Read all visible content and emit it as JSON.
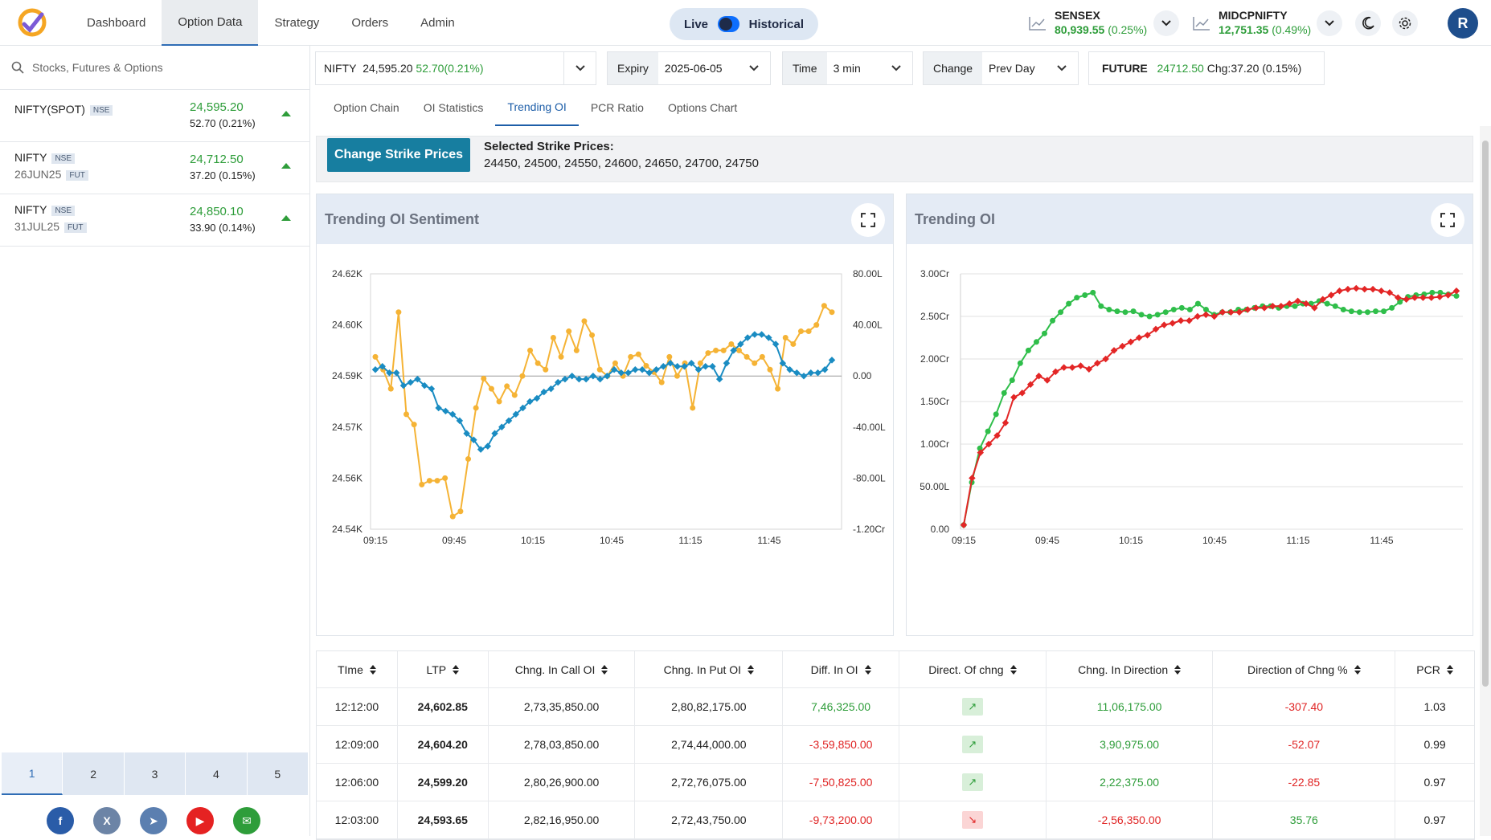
{
  "nav": {
    "items": [
      "Dashboard",
      "Option Data",
      "Strategy",
      "Orders",
      "Admin"
    ],
    "active": "Option Data"
  },
  "mode": {
    "live": "Live",
    "historical": "Historical"
  },
  "indices": [
    {
      "name": "SENSEX",
      "value": "80,939.55",
      "change": "(0.25%)"
    },
    {
      "name": "MIDCPNIFTY",
      "value": "12,751.35",
      "change": "(0.49%)"
    }
  ],
  "user": {
    "initial": "R"
  },
  "search": {
    "placeholder": "Stocks, Futures & Options"
  },
  "watchlist": [
    {
      "symbol": "NIFTY(SPOT)",
      "exchange": "NSE",
      "sub": "",
      "type": "",
      "ltp": "24,595.20",
      "change": "52.70 (0.21%)"
    },
    {
      "symbol": "NIFTY",
      "exchange": "NSE",
      "sub": "26JUN25",
      "type": "FUT",
      "ltp": "24,712.50",
      "change": "37.20 (0.15%)"
    },
    {
      "symbol": "NIFTY",
      "exchange": "NSE",
      "sub": "31JUL25",
      "type": "FUT",
      "ltp": "24,850.10",
      "change": "33.90 (0.14%)"
    }
  ],
  "pager": [
    "1",
    "2",
    "3",
    "4",
    "5"
  ],
  "filters": {
    "symbol": "NIFTY",
    "symbol_price": "24,595.20",
    "symbol_change": "52.70(0.21%)",
    "expiry_label": "Expiry",
    "expiry": "2025-06-05",
    "time_label": "Time",
    "time": "3 min",
    "change_label": "Change",
    "change": "Prev Day",
    "future_label": "FUTURE",
    "future_price": "24712.50",
    "future_change": "Chg:37.20 (0.15%)"
  },
  "tabs": [
    "Option Chain",
    "OI Statistics",
    "Trending OI",
    "PCR Ratio",
    "Options Chart"
  ],
  "strike": {
    "button": "Change Strike Prices",
    "title": "Selected Strike Prices:",
    "list": "24450, 24500, 24550, 24600, 24650, 24700, 24750"
  },
  "panels": {
    "left_title": "Trending OI Sentiment",
    "right_title": "Trending OI"
  },
  "colors": {
    "accent": "#1d5ea8",
    "positive": "#2e9d3a",
    "negative": "#e02424",
    "series_orange": "#f5b335",
    "series_blue": "#1a8cc2",
    "series_green": "#2fbe4a",
    "series_red": "#e32626"
  },
  "chart_data": [
    {
      "type": "line",
      "title": "Trending OI Sentiment",
      "x_ticks": [
        "09:15",
        "09:45",
        "10:15",
        "10:45",
        "11:15",
        "11:45"
      ],
      "y_left_ticks": [
        "24.62K",
        "24.60K",
        "24.59K",
        "24.57K",
        "24.56K",
        "24.54K"
      ],
      "y_right_ticks": [
        "80.00L",
        "40.00L",
        "0.00",
        "-40.00L",
        "-80.00L",
        "-1.20Cr"
      ],
      "ylim_left": [
        24540,
        24620
      ],
      "ylim_right": [
        -120,
        80
      ],
      "series": [
        {
          "values": [
            15,
            5,
            -10,
            50,
            -30,
            -38,
            -85,
            -82,
            -82,
            -80,
            -110,
            -106,
            -65,
            -25,
            -2,
            -10,
            -20,
            -8,
            -15,
            0,
            20,
            10,
            5,
            30,
            15,
            35,
            20,
            43,
            32,
            5,
            0,
            10,
            0,
            15,
            17,
            8,
            3,
            -5,
            15,
            0,
            10,
            -25,
            10,
            18,
            20,
            20,
            25,
            20,
            15,
            10,
            15,
            5,
            -10,
            30,
            25,
            35,
            35,
            40,
            55,
            50
          ]
        },
        {
          "values": [
            24590,
            24591,
            24589,
            24589,
            24585,
            24586,
            24587,
            24585,
            24584,
            24578,
            24577,
            24576,
            24574,
            24570,
            24568,
            24565,
            24566,
            24570,
            24572,
            24574,
            24576,
            24578,
            24580,
            24581,
            24583,
            24584,
            24586,
            24587,
            24588,
            24587,
            24587,
            24588,
            24587,
            24588,
            24590,
            24589,
            24589,
            24590,
            24590,
            24589,
            24590,
            24591,
            24592,
            24591,
            24591,
            24592,
            24590,
            24591,
            24591,
            24587,
            24592,
            24596,
            24598,
            24600,
            24601,
            24601,
            24600,
            24598,
            24592,
            24590,
            24589,
            24588,
            24589,
            24589,
            24590,
            24593
          ]
        }
      ]
    },
    {
      "type": "line",
      "title": "Trending OI",
      "x_ticks": [
        "09:15",
        "09:45",
        "10:15",
        "10:45",
        "11:15",
        "11:45"
      ],
      "y_ticks": [
        "3.00Cr",
        "2.50Cr",
        "2.00Cr",
        "1.50Cr",
        "1.00Cr",
        "50.00L",
        "0.00"
      ],
      "ylim": [
        0,
        3.0
      ],
      "series": [
        {
          "values": [
            0.05,
            0.55,
            0.95,
            1.15,
            1.35,
            1.6,
            1.75,
            1.95,
            2.1,
            2.2,
            2.3,
            2.45,
            2.55,
            2.65,
            2.72,
            2.75,
            2.78,
            2.62,
            2.58,
            2.56,
            2.55,
            2.56,
            2.52,
            2.5,
            2.52,
            2.55,
            2.58,
            2.6,
            2.58,
            2.65,
            2.58,
            2.52,
            2.55,
            2.55,
            2.58,
            2.58,
            2.6,
            2.62,
            2.62,
            2.6,
            2.62,
            2.62,
            2.65,
            2.65,
            2.68,
            2.65,
            2.62,
            2.58,
            2.56,
            2.55,
            2.55,
            2.56,
            2.56,
            2.6,
            2.67,
            2.73,
            2.75,
            2.76,
            2.78,
            2.78,
            2.76,
            2.74
          ]
        },
        {
          "values": [
            0.05,
            0.6,
            0.9,
            1.0,
            1.1,
            1.25,
            1.55,
            1.6,
            1.7,
            1.8,
            1.75,
            1.85,
            1.9,
            1.9,
            1.92,
            1.88,
            1.95,
            2.0,
            2.1,
            2.15,
            2.2,
            2.25,
            2.28,
            2.35,
            2.4,
            2.42,
            2.45,
            2.45,
            2.5,
            2.52,
            2.5,
            2.55,
            2.55,
            2.55,
            2.58,
            2.6,
            2.6,
            2.62,
            2.62,
            2.65,
            2.68,
            2.65,
            2.6,
            2.7,
            2.75,
            2.8,
            2.82,
            2.83,
            2.82,
            2.82,
            2.8,
            2.78,
            2.72,
            2.7,
            2.72,
            2.72,
            2.72,
            2.73,
            2.75,
            2.8
          ]
        }
      ]
    }
  ],
  "table": {
    "headers": [
      "TIme",
      "LTP",
      "Chng. In Call OI",
      "Chng. In Put OI",
      "Diff. In OI",
      "Direct. Of chng",
      "Chng. In Direction",
      "Direction of Chng %",
      "PCR"
    ],
    "rows": [
      {
        "time": "12:12:00",
        "ltp": "24,602.85",
        "call": "2,73,35,850.00",
        "put": "2,80,82,175.00",
        "diff": "7,46,325.00",
        "diff_sign": "pos",
        "dir": "up",
        "dirchg": "11,06,175.00",
        "dirchg_sign": "pos",
        "pct": "-307.40",
        "pct_sign": "neg",
        "pcr": "1.03"
      },
      {
        "time": "12:09:00",
        "ltp": "24,604.20",
        "call": "2,78,03,850.00",
        "put": "2,74,44,000.00",
        "diff": "-3,59,850.00",
        "diff_sign": "neg",
        "dir": "up",
        "dirchg": "3,90,975.00",
        "dirchg_sign": "pos",
        "pct": "-52.07",
        "pct_sign": "neg",
        "pcr": "0.99"
      },
      {
        "time": "12:06:00",
        "ltp": "24,599.20",
        "call": "2,80,26,900.00",
        "put": "2,72,76,075.00",
        "diff": "-7,50,825.00",
        "diff_sign": "neg",
        "dir": "up",
        "dirchg": "2,22,375.00",
        "dirchg_sign": "pos",
        "pct": "-22.85",
        "pct_sign": "neg",
        "pcr": "0.97"
      },
      {
        "time": "12:03:00",
        "ltp": "24,593.65",
        "call": "2,82,16,950.00",
        "put": "2,72,43,750.00",
        "diff": "-9,73,200.00",
        "diff_sign": "neg",
        "dir": "dn",
        "dirchg": "-2,56,350.00",
        "dirchg_sign": "neg",
        "pct": "35.76",
        "pct_sign": "pos",
        "pcr": "0.97"
      }
    ]
  }
}
